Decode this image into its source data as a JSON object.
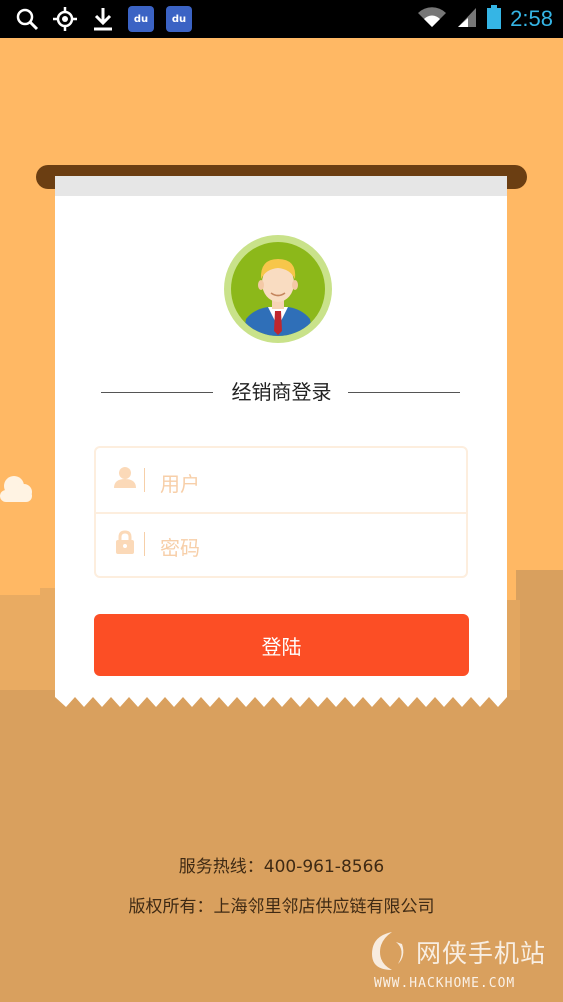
{
  "status_bar": {
    "left_icons": [
      "search-icon",
      "location-icon",
      "download-icon",
      "baidu-icon",
      "baidu-icon"
    ],
    "baidu_label": "du",
    "right_icons": [
      "wifi-icon",
      "signal-icon",
      "battery-icon"
    ],
    "time": "2:58",
    "time_color": "#35b5e5"
  },
  "login": {
    "title": "经销商登录",
    "username_placeholder": "用户",
    "password_placeholder": "密码",
    "login_button": "登陆"
  },
  "footer": {
    "hotline": "服务热线：400-961-8566",
    "copyright": "版权所有：上海邻里邻店供应链有限公司"
  },
  "watermark": {
    "cn": "网侠手机站",
    "en": "WWW.HACKHOME.COM"
  },
  "colors": {
    "background": "#ffb864",
    "ground": "#d9a05e",
    "roller": "#6b3e12",
    "button": "#fc4e25",
    "placeholder": "#f7cfa9"
  }
}
